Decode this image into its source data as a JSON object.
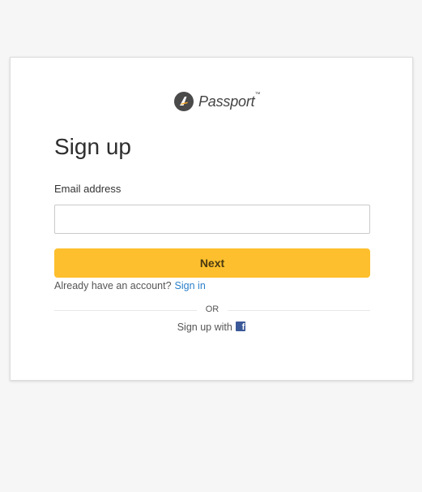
{
  "brand": {
    "name": "Passport",
    "trademark": "™",
    "logo_icon": "passport-logo-icon"
  },
  "form": {
    "title": "Sign up",
    "email_label": "Email address",
    "email_value": "",
    "email_placeholder": "",
    "next_label": "Next"
  },
  "account": {
    "prompt": "Already have an account?",
    "sign_in_label": "Sign in"
  },
  "divider": {
    "label": "OR"
  },
  "social": {
    "label": "Sign up with",
    "provider_icon": "facebook-icon"
  },
  "colors": {
    "background": "#f6f6f6",
    "card": "#ffffff",
    "accent": "#fdbf2d",
    "link": "#2a7fc9",
    "facebook": "#3b5998"
  }
}
